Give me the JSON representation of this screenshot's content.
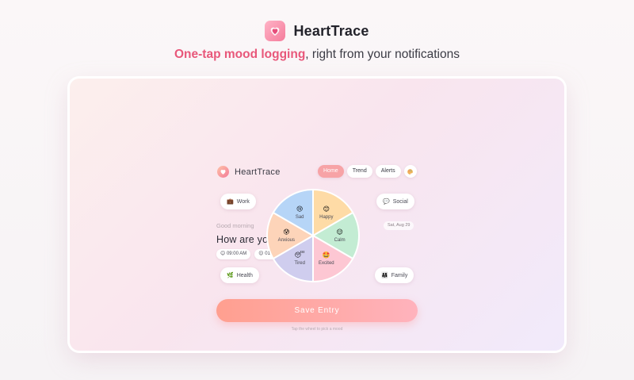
{
  "header": {
    "app_name": "HeartTrace",
    "tagline_accent": "One-tap mood logging",
    "tagline_rest": ", right from your notifications"
  },
  "app": {
    "brand": "HeartTrace",
    "nav": [
      {
        "label": "Home",
        "active": true
      },
      {
        "label": "Trend",
        "active": false
      },
      {
        "label": "Alerts",
        "active": false
      }
    ],
    "nav_icon": "palette-icon",
    "greeting": "Good morning",
    "date": "Sat, Aug 29",
    "question": "How are you feeling today?",
    "chips": [
      {
        "emoji": "😊",
        "time": "09:00 AM"
      },
      {
        "emoji": "😌",
        "time": "01:17 PM"
      }
    ],
    "contexts": [
      {
        "emoji": "💼",
        "label": "Work"
      },
      {
        "emoji": "💬",
        "label": "Social"
      },
      {
        "emoji": "🌿",
        "label": "Health"
      },
      {
        "emoji": "👨‍👩‍👧",
        "label": "Family"
      }
    ],
    "moods": [
      {
        "label": "Happy",
        "emoji": "😊",
        "color": "#fedba6"
      },
      {
        "label": "Calm",
        "emoji": "😌",
        "color": "#c3ecd3"
      },
      {
        "label": "Excited",
        "emoji": "🤩",
        "color": "#fdc7d3"
      },
      {
        "label": "Tired",
        "emoji": "😴",
        "color": "#cfcdee"
      },
      {
        "label": "Anxious",
        "emoji": "😰",
        "color": "#fdd4b9"
      },
      {
        "label": "Sad",
        "emoji": "😢",
        "color": "#b6d5f7"
      }
    ],
    "save_label": "Save Entry",
    "hint": "Tap the wheel to pick a mood"
  }
}
